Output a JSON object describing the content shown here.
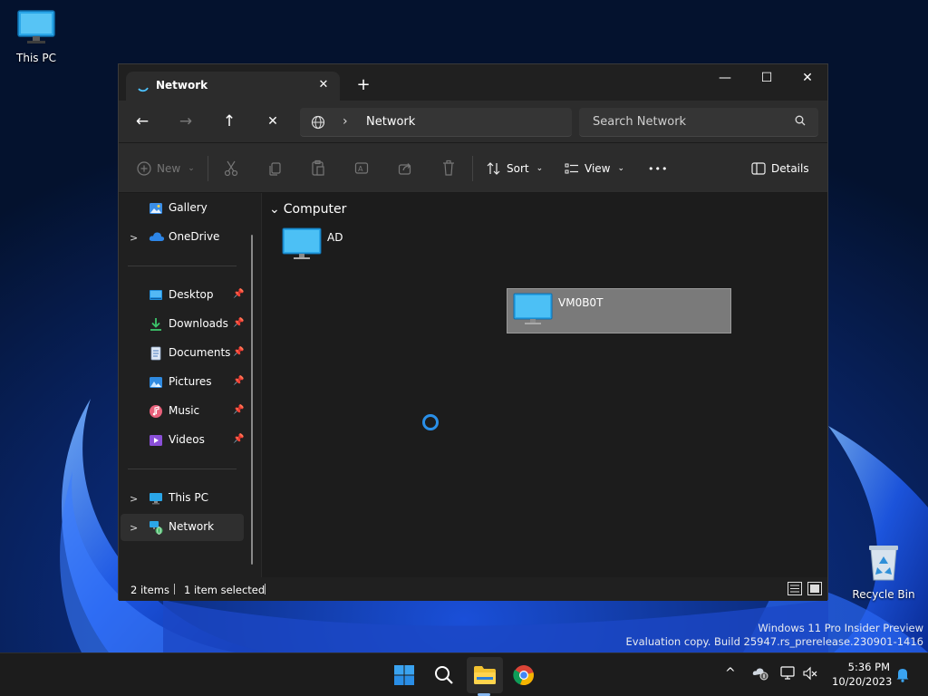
{
  "desktop": {
    "this_pc": "This PC",
    "recycle_bin": "Recycle Bin",
    "watermark_line1": "Windows 11 Pro Insider Preview",
    "watermark_line2": "Evaluation copy. Build 25947.rs_prerelease.230901-1416"
  },
  "window": {
    "tab_title": "Network",
    "tab_close": "✕",
    "new_tab": "+",
    "minimize": "—",
    "maximize": "☐",
    "close": "✕"
  },
  "navbar": {
    "back": "←",
    "forward": "→",
    "up": "↑",
    "stop": "✕",
    "breadcrumb_sep": "›",
    "breadcrumb": "Network",
    "search_placeholder": "Search Network"
  },
  "commandbar": {
    "new": "New",
    "sort": "Sort",
    "view": "View",
    "more": "•••",
    "details": "Details",
    "chevron": "⌄"
  },
  "sidebar": {
    "expand_glyph": ">",
    "pin_glyph": "📌",
    "top": [
      {
        "label": "Gallery"
      },
      {
        "label": "OneDrive"
      }
    ],
    "quick_access": [
      {
        "label": "Desktop"
      },
      {
        "label": "Downloads"
      },
      {
        "label": "Documents"
      },
      {
        "label": "Pictures"
      },
      {
        "label": "Music"
      },
      {
        "label": "Videos"
      }
    ],
    "bottom": [
      {
        "label": "This PC"
      },
      {
        "label": "Network"
      }
    ]
  },
  "content": {
    "group_header": "Computer",
    "group_chevron": "⌄",
    "items": [
      {
        "name": "AD",
        "selected": false
      },
      {
        "name": "VM0B0T",
        "selected": true
      }
    ]
  },
  "status": {
    "items_count": "2 items",
    "selection": "1 item selected"
  },
  "taskbar": {
    "tray_chevron": "^",
    "time": "5:36 PM",
    "date": "10/20/2023"
  },
  "colors": {
    "accent": "#0078d4",
    "folder_yellow": "#f2c230"
  }
}
